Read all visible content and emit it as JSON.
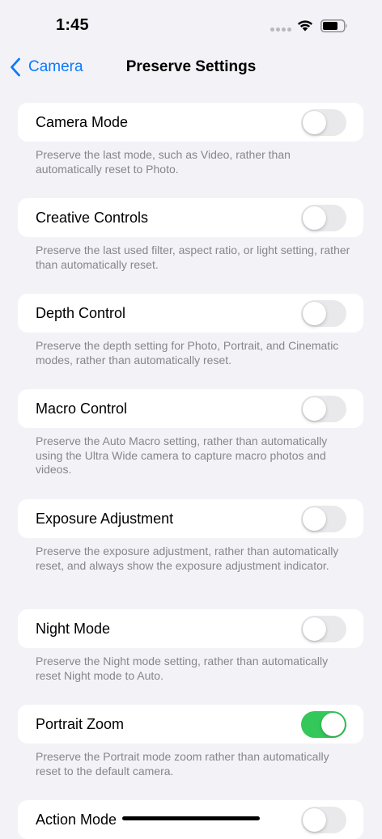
{
  "status_bar": {
    "time": "1:45",
    "icons": [
      "cellular-dots-icon",
      "wifi-icon",
      "battery-icon"
    ]
  },
  "nav": {
    "back_label": "Camera",
    "back_icon": "chevron-left-icon",
    "title": "Preserve Settings"
  },
  "colors": {
    "accent": "#0a7aff",
    "toggle_on": "#34c759",
    "toggle_off": "#e9e9eb",
    "background": "#f2f2f7"
  },
  "settings": [
    {
      "label": "Camera Mode",
      "on": false,
      "description": "Preserve the last mode, such as Video, rather than automatically reset to Photo."
    },
    {
      "label": "Creative Controls",
      "on": false,
      "description": "Preserve the last used filter, aspect ratio, or light setting, rather than automatically reset."
    },
    {
      "label": "Depth Control",
      "on": false,
      "description": "Preserve the depth setting for Photo, Portrait, and Cinematic modes, rather than automatically reset."
    },
    {
      "label": "Macro Control",
      "on": false,
      "description": "Preserve the Auto Macro setting, rather than automatically using the Ultra Wide camera to capture macro photos and videos."
    },
    {
      "label": "Exposure Adjustment",
      "on": false,
      "description": "Preserve the exposure adjustment, rather than automatically reset, and always show the exposure adjustment indicator."
    },
    {
      "label": "Night Mode",
      "on": false,
      "description": "Preserve the Night mode setting, rather than automatically reset Night mode to Auto."
    },
    {
      "label": "Portrait Zoom",
      "on": true,
      "description": "Preserve the Portrait mode zoom rather than automatically reset to the default camera."
    },
    {
      "label": "Action Mode",
      "on": false,
      "description": ""
    }
  ]
}
